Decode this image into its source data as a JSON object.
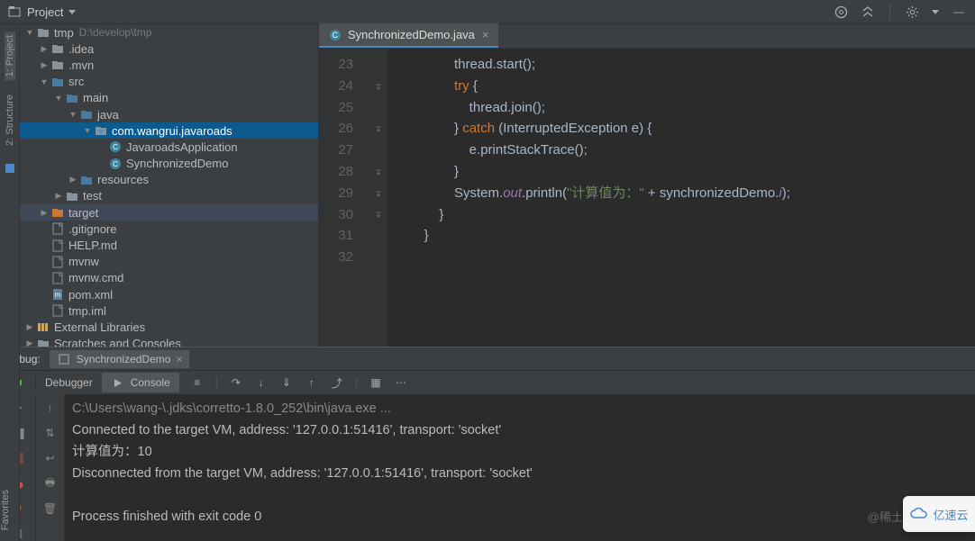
{
  "header": {
    "project_label": "Project"
  },
  "left_rail": {
    "items": [
      "1: Project",
      "2: Structure"
    ]
  },
  "tree": {
    "root": {
      "label": "tmp",
      "path": "D:\\develop\\tmp"
    },
    "items": [
      {
        "indent": 1,
        "arrow": "▶",
        "icon": "folder",
        "label": ".idea"
      },
      {
        "indent": 1,
        "arrow": "▶",
        "icon": "folder",
        "label": ".mvn"
      },
      {
        "indent": 1,
        "arrow": "▼",
        "icon": "folder-b",
        "label": "src"
      },
      {
        "indent": 2,
        "arrow": "▼",
        "icon": "folder-b",
        "label": "main"
      },
      {
        "indent": 3,
        "arrow": "▼",
        "icon": "folder-b",
        "label": "java"
      },
      {
        "indent": 4,
        "arrow": "▼",
        "icon": "package",
        "label": "com.wangrui.javaroads",
        "sel": true
      },
      {
        "indent": 5,
        "arrow": "",
        "icon": "java",
        "label": "JavaroadsApplication"
      },
      {
        "indent": 5,
        "arrow": "",
        "icon": "java",
        "label": "SynchronizedDemo"
      },
      {
        "indent": 3,
        "arrow": "▶",
        "icon": "folder-b",
        "label": "resources"
      },
      {
        "indent": 2,
        "arrow": "▶",
        "icon": "folder",
        "label": "test"
      },
      {
        "indent": 1,
        "arrow": "▶",
        "icon": "folder-t",
        "label": "target",
        "sel2": true
      },
      {
        "indent": 1,
        "arrow": "",
        "icon": "file",
        "label": ".gitignore"
      },
      {
        "indent": 1,
        "arrow": "",
        "icon": "file",
        "label": "HELP.md"
      },
      {
        "indent": 1,
        "arrow": "",
        "icon": "file",
        "label": "mvnw"
      },
      {
        "indent": 1,
        "arrow": "",
        "icon": "file",
        "label": "mvnw.cmd"
      },
      {
        "indent": 1,
        "arrow": "",
        "icon": "file-m",
        "label": "pom.xml"
      },
      {
        "indent": 1,
        "arrow": "",
        "icon": "file",
        "label": "tmp.iml"
      }
    ],
    "extra": [
      {
        "arrow": "▶",
        "icon": "lib",
        "label": "External Libraries"
      },
      {
        "arrow": "▶",
        "icon": "scratch",
        "label": "Scratches and Consoles"
      }
    ]
  },
  "editor": {
    "tab": {
      "label": "SynchronizedDemo.java"
    },
    "lines": [
      {
        "n": 23,
        "html": "            thread.start();"
      },
      {
        "n": 24,
        "html": "            <kw>try</kw> {"
      },
      {
        "n": 25,
        "html": "                thread.join();"
      },
      {
        "n": 26,
        "html": "            } <kw>catch</kw> (InterruptedException e) {"
      },
      {
        "n": 27,
        "html": "                e.printStackTrace();"
      },
      {
        "n": 28,
        "html": "            }"
      },
      {
        "n": 29,
        "html": "            System.<fi>out</fi>.println(<str>\"计算值为：\"</str> + synchronizedDemo.<fi>i</fi>);"
      },
      {
        "n": 30,
        "html": "        }"
      },
      {
        "n": 31,
        "html": "    }"
      },
      {
        "n": 32,
        "html": ""
      }
    ]
  },
  "debug": {
    "title": "Debug:",
    "run_config": "SynchronizedDemo",
    "tabs": {
      "debugger": "Debugger",
      "console": "Console"
    }
  },
  "console": {
    "lines": [
      {
        "cls": "con-gray",
        "text": "C:\\Users\\wang-\\.jdks\\corretto-1.8.0_252\\bin\\java.exe ..."
      },
      {
        "cls": "",
        "text": "Connected to the target VM, address: '127.0.0.1:51416', transport: 'socket'"
      },
      {
        "cls": "",
        "text": "计算值为：10"
      },
      {
        "cls": "",
        "text": "Disconnected from the target VM, address: '127.0.0.1:51416', transport: 'socket'"
      },
      {
        "cls": "",
        "text": ""
      },
      {
        "cls": "",
        "text": "Process finished with exit code 0"
      }
    ]
  },
  "watermark": "@稀土",
  "logo": "亿速云"
}
